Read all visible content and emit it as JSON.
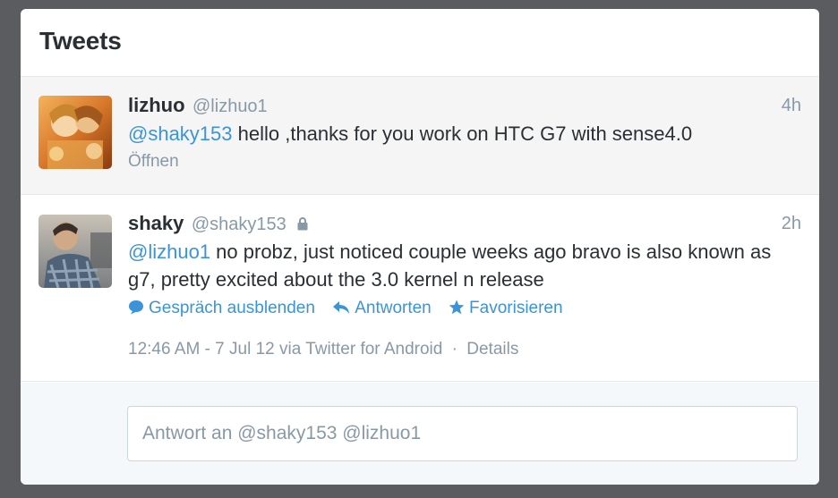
{
  "header": {
    "title": "Tweets"
  },
  "tweets": [
    {
      "fullname": "lizhuo",
      "username": "@lizhuo1",
      "time": "4h",
      "mention": "@shaky153",
      "text": " hello ,thanks for you work on HTC G7 with sense4.0",
      "open_label": "Öffnen",
      "avatar_icon": "profile-photo"
    },
    {
      "fullname": "shaky",
      "username": "@shaky153",
      "protected_icon": "lock-icon",
      "time": "2h",
      "mention": "@lizhuo1",
      "text": " no probz, just noticed couple weeks ago bravo is also known as g7, pretty excited about the 3.0 kernel n release",
      "actions": {
        "conversation": "Gespräch ausblenden",
        "reply": "Antworten",
        "favorite": "Favorisieren"
      },
      "meta": {
        "timestamp": "12:46 AM - 7 Jul 12",
        "via": "via Twitter for Android",
        "separator": "·",
        "details": "Details"
      },
      "avatar_icon": "profile-photo"
    }
  ],
  "reply": {
    "placeholder": "Antwort an @shaky153 @lizhuo1"
  },
  "colors": {
    "background": "#5b5c60",
    "link": "#3b94d9",
    "muted": "#8899a6",
    "text": "#292f33"
  }
}
